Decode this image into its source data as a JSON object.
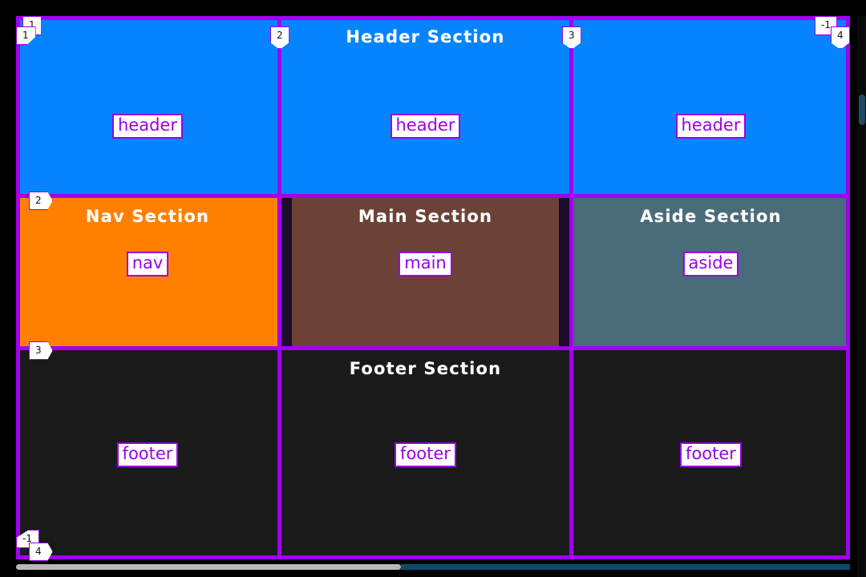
{
  "overlay": {
    "tool": "css-grid-inspector",
    "grid_line_color": "#a100f2",
    "label_bg": "#ffffff",
    "label_border": "#9b00e8",
    "label_text": "#111111"
  },
  "grid": {
    "columns": [
      "328px",
      "365px",
      "347px"
    ],
    "rows": [
      "224px",
      "190px",
      "264px"
    ],
    "column_labels_top": [
      "1",
      "2",
      "3",
      "-1"
    ],
    "column_labels_top_secondary": [
      "1",
      "4"
    ],
    "row_labels_left": [
      "1",
      "2",
      "3",
      "-1"
    ],
    "row_labels_left_secondary": [
      "4"
    ],
    "corner_top_left": {
      "column": "1",
      "row": "1"
    },
    "corner_top_right": {
      "negative": "-1",
      "positive": "4"
    },
    "corner_bottom_left": {
      "negative": "-1",
      "positive": "4"
    }
  },
  "areas": [
    {
      "name": "header",
      "title": "Header Section",
      "tag": "header",
      "color": "#0584fe",
      "title_visible": true,
      "cells": 3
    },
    {
      "name": "nav",
      "title": "Nav Section",
      "tag": "nav",
      "color": "#ff8000",
      "title_visible": true
    },
    {
      "name": "main",
      "title": "Main Section",
      "tag": "main",
      "color": "#6b4235",
      "outer_color": "#1d0b2e",
      "title_visible": true
    },
    {
      "name": "aside",
      "title": "Aside Section",
      "tag": "aside",
      "color": "#4a6b7a",
      "title_visible": true
    },
    {
      "name": "footer",
      "title": "Footer Section",
      "tag": "footer",
      "color": "#1a1a1a",
      "title_visible": true,
      "cells": 3
    }
  ],
  "cells": {
    "header_1_tag": "header",
    "header_2_tag": "header",
    "header_3_tag": "header",
    "header_title": "Header Section",
    "nav_title": "Nav Section",
    "nav_tag": "nav",
    "main_title": "Main Section",
    "main_tag": "main",
    "aside_title": "Aside Section",
    "aside_tag": "aside",
    "footer_title": "Footer Section",
    "footer_1_tag": "footer",
    "footer_2_tag": "footer",
    "footer_3_tag": "footer"
  }
}
